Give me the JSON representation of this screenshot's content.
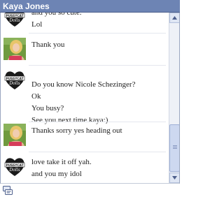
{
  "window": {
    "title": "Kaya Jones"
  },
  "messages": [
    {
      "avatar": "pussycat-dolls-avatar",
      "lines": [
        "and you so cute.",
        "Lol"
      ]
    },
    {
      "avatar": "blonde-photo-avatar",
      "lines": [
        "Thank you"
      ]
    },
    {
      "avatar": "pussycat-dolls-avatar",
      "lines": [
        "Do you know Nicole Schezinger?",
        "Ok",
        "You busy?",
        "See you next time kaya:)"
      ]
    },
    {
      "avatar": "blonde-photo-avatar",
      "lines": [
        "Thanks sorry yes heading out"
      ]
    },
    {
      "avatar": "pussycat-dolls-avatar",
      "lines": [
        "love take it off yah.",
        "and you my idol"
      ]
    }
  ],
  "badge": {
    "line1": "PUSSYCAT",
    "line2": "Dolls"
  },
  "scroll": {
    "position": 0.93
  },
  "colors": {
    "titlebar": "#6d84b4",
    "text": "#222222"
  },
  "footer": {
    "icon": "emoticon-icon"
  }
}
